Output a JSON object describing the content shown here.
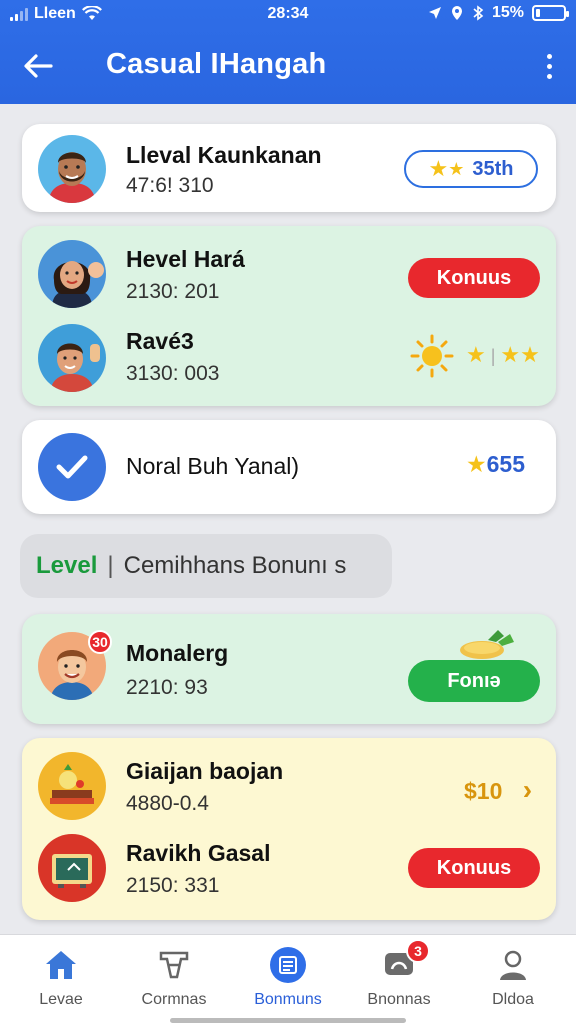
{
  "status_bar": {
    "carrier": "Lleen",
    "time": "28:34",
    "battery": "15%"
  },
  "app_bar": {
    "title": "Casual IHangah"
  },
  "cards": [
    {
      "rows": [
        {
          "name": "Lleval Kaunkanan",
          "sub": "47:6! 310",
          "badge_text": "35th",
          "badge_icon": "star-icon",
          "avatar": "man-beard"
        }
      ]
    },
    {
      "rows": [
        {
          "name": "Hevel Hará",
          "sub": "2130: 201",
          "button": "Konuus",
          "avatar": "woman"
        },
        {
          "name": "Ravé3",
          "sub": "3130: 003",
          "avatar": "boy"
        }
      ]
    },
    {
      "rows": [
        {
          "name": "Noral Buh Yanal)",
          "points": "655"
        }
      ]
    }
  ],
  "section": {
    "level_label": "Level",
    "separator": "|",
    "title": "Cemihhans Bonunı s"
  },
  "cards2": [
    {
      "rows": [
        {
          "name": "Monalerg",
          "sub": "2210: 93",
          "button": "Fonıə",
          "avatar_badge": "30"
        }
      ]
    },
    {
      "rows": [
        {
          "name": "Giaijan baojan",
          "sub": "4880-0.4",
          "amount": "$10",
          "chevron": "›"
        },
        {
          "name": "Ravikh Gasal",
          "sub": "2150: 331",
          "button": "Konuus"
        }
      ]
    }
  ],
  "bottom_nav": [
    {
      "label": "Levae",
      "icon": "home-icon",
      "active": false
    },
    {
      "label": "Cormnas",
      "icon": "tools-icon",
      "active": false
    },
    {
      "label": "Bonmuns",
      "icon": "bonus-icon",
      "active": true
    },
    {
      "label": "Bnonnas",
      "icon": "chat-icon",
      "active": false,
      "badge": "3"
    },
    {
      "label": "Dldoa",
      "icon": "profile-icon",
      "active": false
    }
  ],
  "colors": {
    "primary": "#2f6ee8",
    "accent_red": "#e8282d",
    "accent_green": "#24b14b",
    "star": "#f5c21a"
  }
}
